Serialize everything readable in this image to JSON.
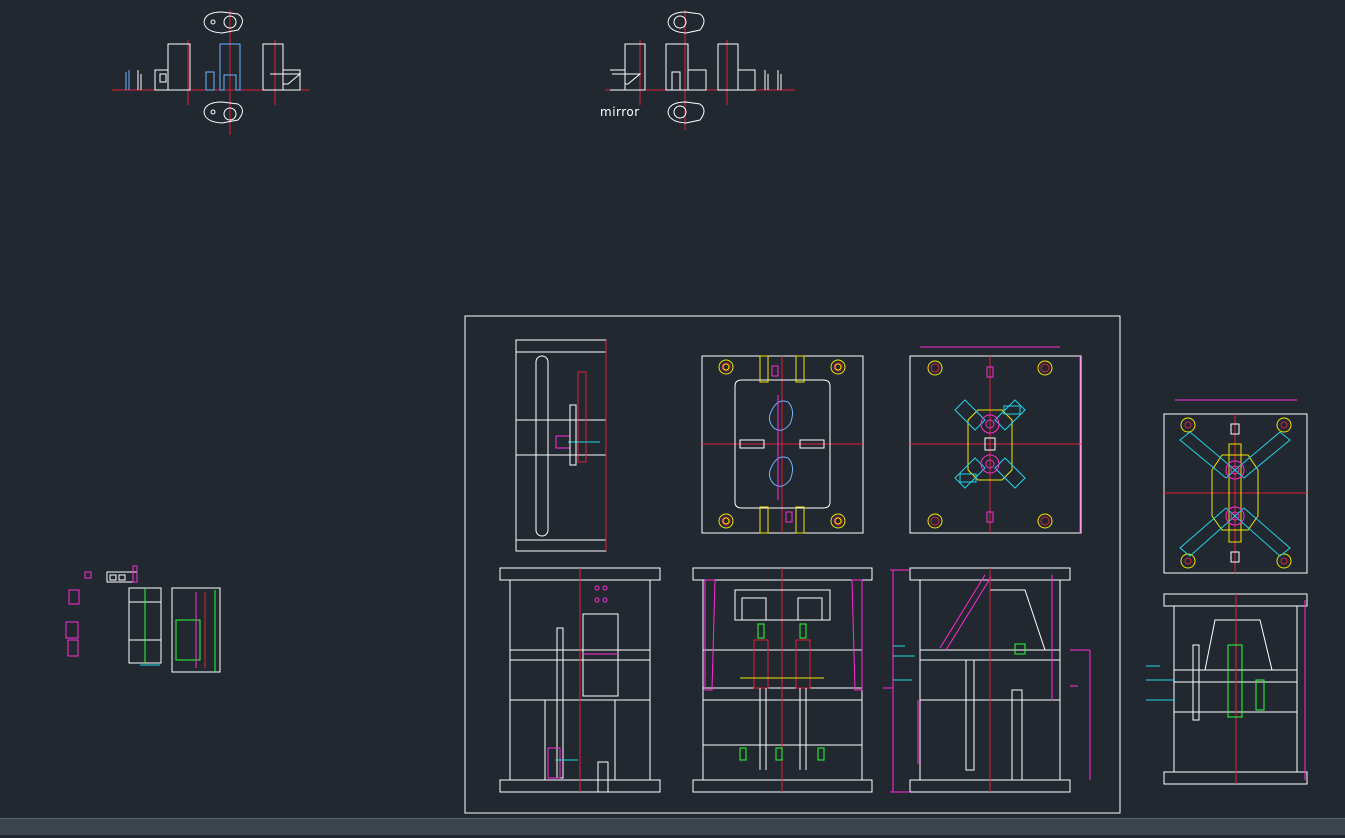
{
  "labels": {
    "mirror": "mirror"
  },
  "colors": {
    "background": "#212830",
    "line": "#ffffff",
    "center_line": "#e0203a",
    "cyan": "#22d3e6",
    "yellow": "#f2e600",
    "magenta": "#ff2bd6",
    "green": "#2bff3a",
    "part_blue": "#6fb4ff",
    "status_bar": "#3b434c"
  },
  "icons": {
    "bolt": "circle-bolt-icon",
    "ejector": "ejector-pin-icon"
  }
}
